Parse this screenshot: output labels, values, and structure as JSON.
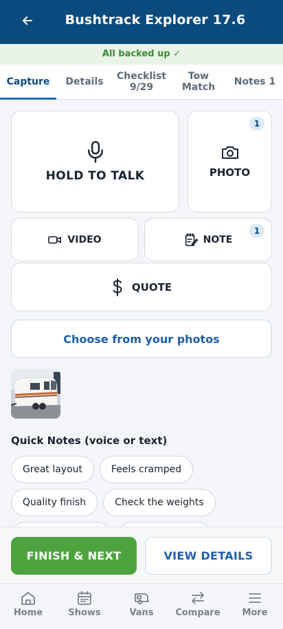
{
  "header": {
    "title": "Bushtrack Explorer 17.6",
    "back_icon": "arrow-left-icon"
  },
  "status": {
    "backup_text": "All backed up ✓",
    "color": "#3c8a34"
  },
  "tabs": [
    {
      "label": "Capture",
      "active": true
    },
    {
      "label": "Details",
      "active": false
    },
    {
      "label": "Checklist 9/29",
      "active": false
    },
    {
      "label": "Tow Match",
      "active": false
    },
    {
      "label": "Notes 1",
      "active": false
    }
  ],
  "capture": {
    "hold_to_talk": {
      "label": "HOLD TO TALK",
      "icon": "microphone-icon"
    },
    "photo": {
      "label": "PHOTO",
      "icon": "camera-icon",
      "badge": "1"
    },
    "video": {
      "label": "VIDEO",
      "icon": "video-camera-icon"
    },
    "note": {
      "label": "NOTE",
      "icon": "notepad-icon",
      "badge": "1"
    },
    "quote": {
      "label": "QUOTE",
      "icon": "dollar-icon"
    },
    "choose_photos": "Choose from your photos"
  },
  "quick_notes": {
    "title": "Quick Notes (voice or text)",
    "chips": [
      "Great layout",
      "Feels cramped",
      "Quality finish",
      "Check the weights"
    ]
  },
  "actions": {
    "finish": "FINISH & NEXT",
    "view_details": "VIEW DETAILS"
  },
  "bottom_nav": [
    {
      "label": "Home",
      "icon": "home-icon"
    },
    {
      "label": "Shows",
      "icon": "calendar-icon"
    },
    {
      "label": "Vans",
      "icon": "caravan-icon"
    },
    {
      "label": "Compare",
      "icon": "compare-arrows-icon"
    },
    {
      "label": "More",
      "icon": "menu-icon"
    }
  ],
  "colors": {
    "header": "#0b4a7d",
    "accent": "#1e66b8",
    "finish": "#4da43f"
  }
}
